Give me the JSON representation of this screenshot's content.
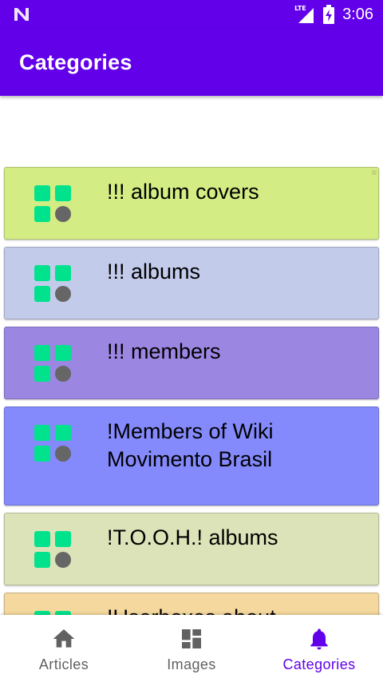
{
  "status_bar": {
    "time": "3:06",
    "network": "LTE"
  },
  "app_bar": {
    "title": "Categories"
  },
  "categories": [
    {
      "label": "!!! album covers",
      "color": "#d4ec84"
    },
    {
      "label": "!!! albums",
      "color": "#c3cbeb"
    },
    {
      "label": "!!! members",
      "color": "#9b86e2"
    },
    {
      "label": "!Members of Wiki Movimento Brasil",
      "color": "#8489fc"
    },
    {
      "label": "!T.O.O.H.! albums",
      "color": "#dce3b8"
    },
    {
      "label": "!Userboxes about",
      "color": "#f4d89e"
    }
  ],
  "icon_colors": {
    "squares": "#00e38c",
    "circle": "#666666"
  },
  "bottom_nav": {
    "items": [
      {
        "label": "Articles",
        "icon": "home-icon",
        "active": false
      },
      {
        "label": "Images",
        "icon": "dashboard-icon",
        "active": false
      },
      {
        "label": "Categories",
        "icon": "bell-icon",
        "active": true
      }
    ]
  },
  "colors": {
    "primary": "#6200ea",
    "inactive": "#616161",
    "background": "#ffffff"
  }
}
